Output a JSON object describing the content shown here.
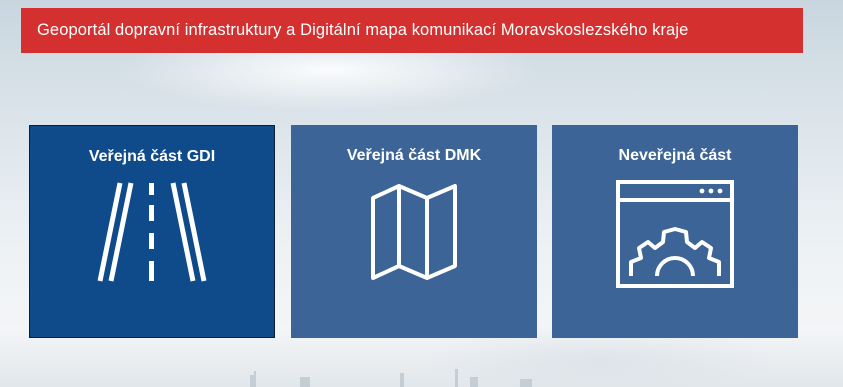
{
  "header": {
    "title": "Geoportál dopravní infrastruktury a Digitální mapa komunikací Moravskoslezského kraje"
  },
  "tiles": [
    {
      "label": "Veřejná část GDI",
      "icon": "road-icon",
      "active": true
    },
    {
      "label": "Veřejná část DMK",
      "icon": "map-icon",
      "active": false
    },
    {
      "label": "Neveřejná část",
      "icon": "settings-window-icon",
      "active": false
    }
  ],
  "colors": {
    "header": "#d3302f",
    "tile": "#3c6496",
    "tile_active": "#0f4a8a",
    "text": "#ffffff"
  }
}
